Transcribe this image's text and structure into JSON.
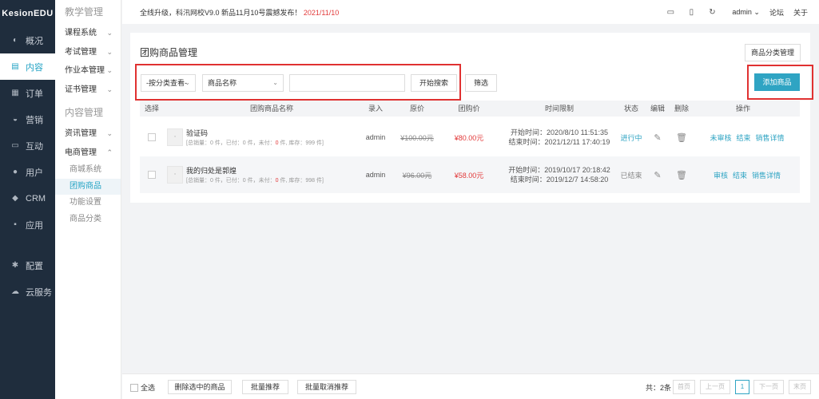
{
  "brand": "KesionEDU",
  "nav": [
    {
      "label": "概况",
      "icon": "dashboard-icon",
      "glyph": "◐"
    },
    {
      "label": "内容",
      "icon": "content-icon",
      "glyph": "▤"
    },
    {
      "label": "订单",
      "icon": "order-icon",
      "glyph": "▦"
    },
    {
      "label": "营销",
      "icon": "marketing-icon",
      "glyph": "◒"
    },
    {
      "label": "互动",
      "icon": "chat-icon",
      "glyph": "▭"
    },
    {
      "label": "用户",
      "icon": "user-icon",
      "glyph": "●"
    },
    {
      "label": "CRM",
      "icon": "crm-icon",
      "glyph": "◆"
    },
    {
      "label": "应用",
      "icon": "apps-icon",
      "glyph": "▪"
    },
    {
      "label": "配置",
      "icon": "gear-icon",
      "glyph": "✱"
    },
    {
      "label": "云服务",
      "icon": "cloud-icon",
      "glyph": "☁"
    }
  ],
  "submenu": {
    "head1": "教学管理",
    "items1": [
      "课程系统",
      "考试管理",
      "作业本管理",
      "证书管理"
    ],
    "head2": "内容管理",
    "items2": [
      "资讯管理",
      "电商管理"
    ],
    "children": [
      "商城系统",
      "团购商品",
      "功能设置",
      "商品分类"
    ]
  },
  "topbar": {
    "notice": "全线升级，科汛网校V9.0 新品11月10号震撼发布！",
    "notice_date": "2021/11/10",
    "user": "admin",
    "forum": "论坛",
    "about": "关于"
  },
  "page": {
    "title": "团购商品管理",
    "category_btn": "商品分类管理",
    "category_select": "-按分类查看-",
    "field_select": "商品名称",
    "search_value": "",
    "search_btn": "开始搜索",
    "filter_btn": "筛选",
    "add_btn": "添加商品"
  },
  "table": {
    "headers": [
      "选择",
      "团购商品名称",
      "录入",
      "原价",
      "团购价",
      "时间限制",
      "状态",
      "编辑",
      "删除",
      "操作"
    ],
    "rows": [
      {
        "name": "验证码",
        "stat_pre": "[总销量：0 件，已付：0 件，未付：",
        "stat_unpaid": "0",
        "stat_post": " 件, 库存：999 件]",
        "author": "admin",
        "orig": "¥100.00元",
        "price": "¥80.00元",
        "start": "开始时间：2020/8/10 11:51:35",
        "end": "结束时间：2021/12/11 17:40:19",
        "status": "进行中",
        "ops": [
          "未审核",
          "结束",
          "销售详情"
        ]
      },
      {
        "name": "我的归处是郭煌",
        "stat_pre": "[总销量：0 件，已付：0 件，未付：",
        "stat_unpaid": "0",
        "stat_post": " 件, 库存：998 件]",
        "author": "admin",
        "orig": "¥96.00元",
        "price": "¥58.00元",
        "start": "开始时间：2019/10/17 20:18:42",
        "end": "结束时间：2019/12/7 14:58:20",
        "status": "已结束",
        "ops": [
          "审核",
          "结束",
          "销售详情"
        ]
      }
    ]
  },
  "bottom": {
    "select_all": "全选",
    "delete_btn": "删除选中的商品",
    "recommend_btn": "批量推荐",
    "unrecommend_btn": "批量取消推荐",
    "total": "共：2条",
    "first": "首页",
    "prev": "上一页",
    "current": "1",
    "next": "下一页",
    "last": "末页"
  }
}
